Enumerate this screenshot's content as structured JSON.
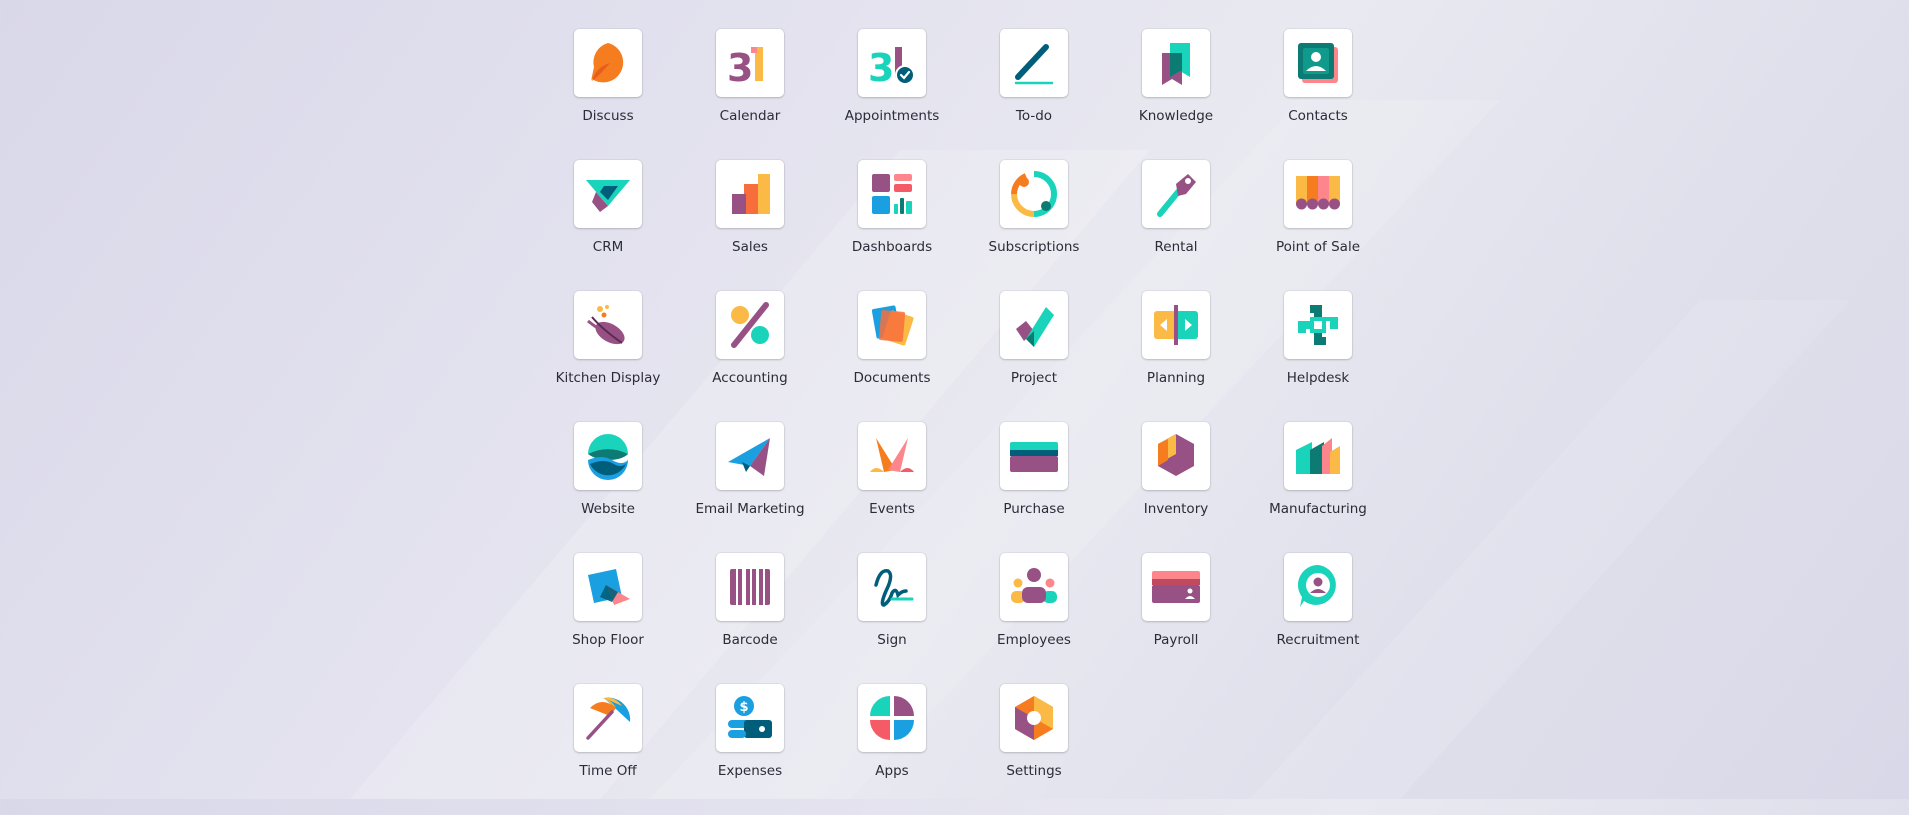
{
  "apps": [
    {
      "label": "Discuss",
      "icon": "discuss-icon"
    },
    {
      "label": "Calendar",
      "icon": "calendar-icon"
    },
    {
      "label": "Appointments",
      "icon": "appointments-icon"
    },
    {
      "label": "To-do",
      "icon": "todo-icon"
    },
    {
      "label": "Knowledge",
      "icon": "knowledge-icon"
    },
    {
      "label": "Contacts",
      "icon": "contacts-icon"
    },
    {
      "label": "CRM",
      "icon": "crm-icon"
    },
    {
      "label": "Sales",
      "icon": "sales-icon"
    },
    {
      "label": "Dashboards",
      "icon": "dashboards-icon"
    },
    {
      "label": "Subscriptions",
      "icon": "subscriptions-icon"
    },
    {
      "label": "Rental",
      "icon": "rental-icon"
    },
    {
      "label": "Point of Sale",
      "icon": "point-of-sale-icon"
    },
    {
      "label": "Kitchen Display",
      "icon": "kitchen-display-icon"
    },
    {
      "label": "Accounting",
      "icon": "accounting-icon"
    },
    {
      "label": "Documents",
      "icon": "documents-icon"
    },
    {
      "label": "Project",
      "icon": "project-icon"
    },
    {
      "label": "Planning",
      "icon": "planning-icon"
    },
    {
      "label": "Helpdesk",
      "icon": "helpdesk-icon"
    },
    {
      "label": "Website",
      "icon": "website-icon"
    },
    {
      "label": "Email Marketing",
      "icon": "email-marketing-icon"
    },
    {
      "label": "Events",
      "icon": "events-icon"
    },
    {
      "label": "Purchase",
      "icon": "purchase-icon"
    },
    {
      "label": "Inventory",
      "icon": "inventory-icon"
    },
    {
      "label": "Manufacturing",
      "icon": "manufacturing-icon"
    },
    {
      "label": "Shop Floor",
      "icon": "shop-floor-icon"
    },
    {
      "label": "Barcode",
      "icon": "barcode-icon"
    },
    {
      "label": "Sign",
      "icon": "sign-icon"
    },
    {
      "label": "Employees",
      "icon": "employees-icon"
    },
    {
      "label": "Payroll",
      "icon": "payroll-icon"
    },
    {
      "label": "Recruitment",
      "icon": "recruitment-icon"
    },
    {
      "label": "Time Off",
      "icon": "time-off-icon"
    },
    {
      "label": "Expenses",
      "icon": "expenses-icon"
    },
    {
      "label": "Apps",
      "icon": "apps-icon"
    },
    {
      "label": "Settings",
      "icon": "settings-icon"
    }
  ],
  "calendar_icon_text": "31",
  "colors": {
    "purple": "#985184",
    "teal": "#1ad3bb",
    "dark_teal": "#005e7a",
    "orange": "#fc868b",
    "yellow": "#fbb945",
    "blue": "#1a9fe0"
  }
}
